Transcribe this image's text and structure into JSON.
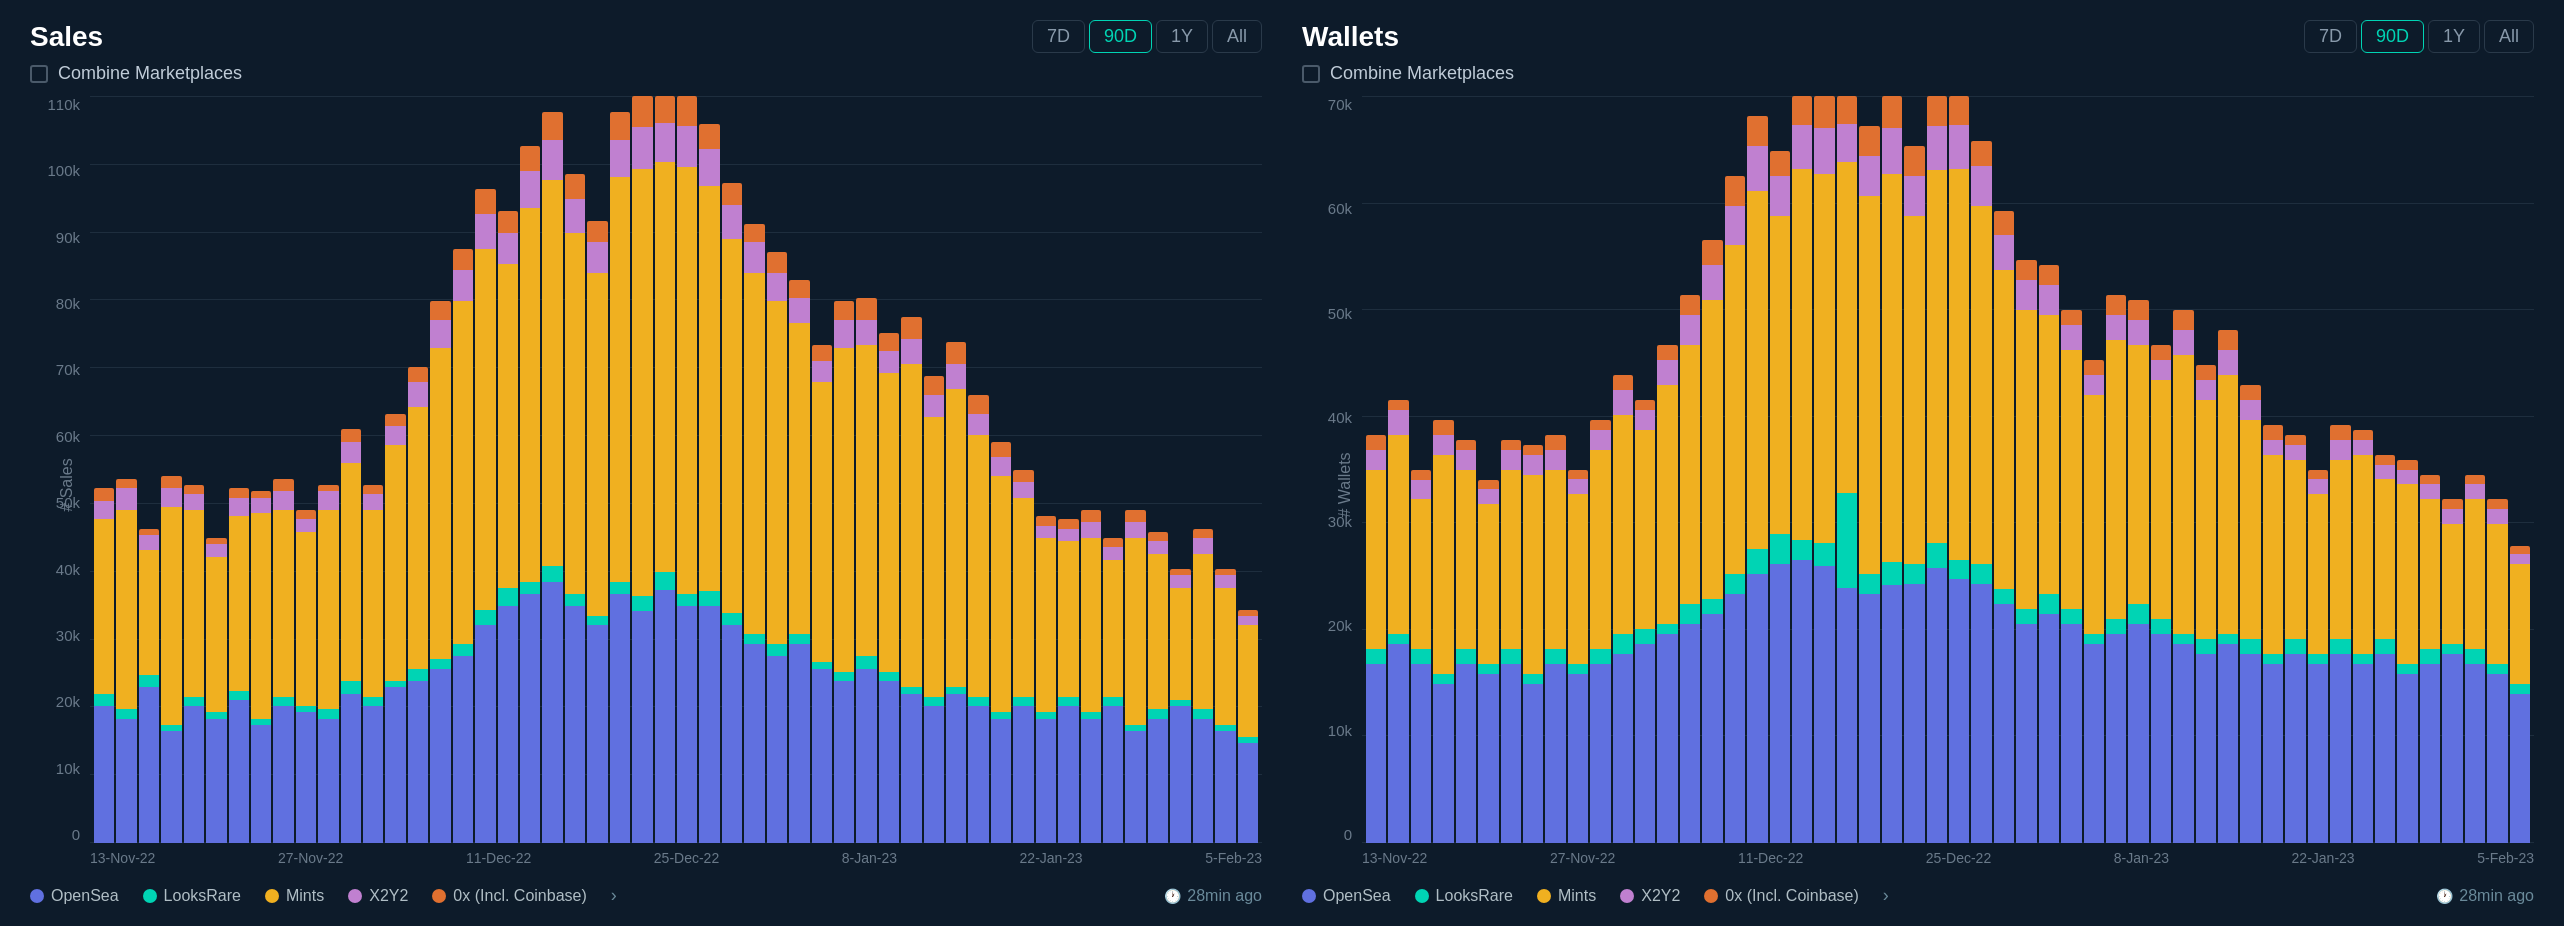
{
  "charts": [
    {
      "id": "sales",
      "title": "Sales",
      "yLabel": "# Sales",
      "yTicks": [
        "110k",
        "100k",
        "90k",
        "80k",
        "70k",
        "60k",
        "50k",
        "40k",
        "30k",
        "20k",
        "10k",
        "0"
      ],
      "maxVal": 120000,
      "xLabels": [
        "13-Nov-22",
        "27-Nov-22",
        "11-Dec-22",
        "25-Dec-22",
        "8-Jan-23",
        "22-Jan-23",
        "5-Feb-23"
      ],
      "activeFilter": "90D",
      "filters": [
        "7D",
        "90D",
        "1Y",
        "All"
      ],
      "combineLabel": "Combine Marketplaces"
    },
    {
      "id": "wallets",
      "title": "Wallets",
      "yLabel": "# Wallets",
      "yTicks": [
        "70k",
        "60k",
        "50k",
        "40k",
        "30k",
        "20k",
        "10k",
        "0"
      ],
      "maxVal": 75000,
      "xLabels": [
        "13-Nov-22",
        "27-Nov-22",
        "11-Dec-22",
        "25-Dec-22",
        "8-Jan-23",
        "22-Jan-23",
        "5-Feb-23"
      ],
      "activeFilter": "90D",
      "filters": [
        "7D",
        "90D",
        "1Y",
        "All"
      ],
      "combineLabel": "Combine Marketplaces"
    }
  ],
  "legend": {
    "items": [
      {
        "label": "OpenSea",
        "color": "#6070e0"
      },
      {
        "label": "LooksRare",
        "color": "#00d4b4"
      },
      {
        "label": "Mints",
        "color": "#f0b020"
      },
      {
        "label": "X2Y2",
        "color": "#c080d0"
      },
      {
        "label": "0x (Incl. Coinbase)",
        "color": "#e07030"
      }
    ],
    "moreLabel": ">",
    "timestamp": "28min ago"
  },
  "salesBars": [
    {
      "opensea": 22000,
      "looksrare": 2000,
      "mints": 28000,
      "x2y2": 3000,
      "ox": 2000
    },
    {
      "opensea": 20000,
      "looksrare": 1500,
      "mints": 32000,
      "x2y2": 3500,
      "ox": 1500
    },
    {
      "opensea": 25000,
      "looksrare": 2000,
      "mints": 20000,
      "x2y2": 2500,
      "ox": 1000
    },
    {
      "opensea": 18000,
      "looksrare": 1000,
      "mints": 35000,
      "x2y2": 3000,
      "ox": 2000
    },
    {
      "opensea": 22000,
      "looksrare": 1500,
      "mints": 30000,
      "x2y2": 2500,
      "ox": 1500
    },
    {
      "opensea": 20000,
      "looksrare": 1000,
      "mints": 25000,
      "x2y2": 2000,
      "ox": 1000
    },
    {
      "opensea": 23000,
      "looksrare": 1500,
      "mints": 28000,
      "x2y2": 3000,
      "ox": 1500
    },
    {
      "opensea": 19000,
      "looksrare": 1000,
      "mints": 33000,
      "x2y2": 2500,
      "ox": 1000
    },
    {
      "opensea": 22000,
      "looksrare": 1500,
      "mints": 30000,
      "x2y2": 3000,
      "ox": 2000
    },
    {
      "opensea": 21000,
      "looksrare": 1000,
      "mints": 28000,
      "x2y2": 2000,
      "ox": 1500
    },
    {
      "opensea": 20000,
      "looksrare": 1500,
      "mints": 32000,
      "x2y2": 3000,
      "ox": 1000
    },
    {
      "opensea": 24000,
      "looksrare": 2000,
      "mints": 35000,
      "x2y2": 3500,
      "ox": 2000
    },
    {
      "opensea": 22000,
      "looksrare": 1500,
      "mints": 30000,
      "x2y2": 2500,
      "ox": 1500
    },
    {
      "opensea": 25000,
      "looksrare": 1000,
      "mints": 38000,
      "x2y2": 3000,
      "ox": 2000
    },
    {
      "opensea": 26000,
      "looksrare": 2000,
      "mints": 42000,
      "x2y2": 4000,
      "ox": 2500
    },
    {
      "opensea": 28000,
      "looksrare": 1500,
      "mints": 50000,
      "x2y2": 4500,
      "ox": 3000
    },
    {
      "opensea": 30000,
      "looksrare": 2000,
      "mints": 55000,
      "x2y2": 5000,
      "ox": 3500
    },
    {
      "opensea": 35000,
      "looksrare": 2500,
      "mints": 58000,
      "x2y2": 5500,
      "ox": 4000
    },
    {
      "opensea": 38000,
      "looksrare": 3000,
      "mints": 52000,
      "x2y2": 5000,
      "ox": 3500
    },
    {
      "opensea": 40000,
      "looksrare": 2000,
      "mints": 60000,
      "x2y2": 6000,
      "ox": 4000
    },
    {
      "opensea": 42000,
      "looksrare": 2500,
      "mints": 62000,
      "x2y2": 6500,
      "ox": 4500
    },
    {
      "opensea": 38000,
      "looksrare": 2000,
      "mints": 58000,
      "x2y2": 5500,
      "ox": 4000
    },
    {
      "opensea": 35000,
      "looksrare": 1500,
      "mints": 55000,
      "x2y2": 5000,
      "ox": 3500
    },
    {
      "opensea": 40000,
      "looksrare": 2000,
      "mints": 65000,
      "x2y2": 6000,
      "ox": 4500
    },
    {
      "opensea": 38000,
      "looksrare": 2500,
      "mints": 70000,
      "x2y2": 7000,
      "ox": 5000
    },
    {
      "opensea": 42000,
      "looksrare": 3000,
      "mints": 68000,
      "x2y2": 6500,
      "ox": 4500
    },
    {
      "opensea": 40000,
      "looksrare": 2000,
      "mints": 72000,
      "x2y2": 7000,
      "ox": 5000
    },
    {
      "opensea": 38000,
      "looksrare": 2500,
      "mints": 65000,
      "x2y2": 6000,
      "ox": 4000
    },
    {
      "opensea": 35000,
      "looksrare": 2000,
      "mints": 60000,
      "x2y2": 5500,
      "ox": 3500
    },
    {
      "opensea": 32000,
      "looksrare": 1500,
      "mints": 58000,
      "x2y2": 5000,
      "ox": 3000
    },
    {
      "opensea": 30000,
      "looksrare": 2000,
      "mints": 55000,
      "x2y2": 4500,
      "ox": 3500
    },
    {
      "opensea": 32000,
      "looksrare": 1500,
      "mints": 50000,
      "x2y2": 4000,
      "ox": 3000
    },
    {
      "opensea": 28000,
      "looksrare": 1000,
      "mints": 45000,
      "x2y2": 3500,
      "ox": 2500
    },
    {
      "opensea": 26000,
      "looksrare": 1500,
      "mints": 52000,
      "x2y2": 4500,
      "ox": 3000
    },
    {
      "opensea": 28000,
      "looksrare": 2000,
      "mints": 50000,
      "x2y2": 4000,
      "ox": 3500
    },
    {
      "opensea": 26000,
      "looksrare": 1500,
      "mints": 48000,
      "x2y2": 3500,
      "ox": 3000
    },
    {
      "opensea": 24000,
      "looksrare": 1000,
      "mints": 52000,
      "x2y2": 4000,
      "ox": 3500
    },
    {
      "opensea": 22000,
      "looksrare": 1500,
      "mints": 45000,
      "x2y2": 3500,
      "ox": 3000
    },
    {
      "opensea": 24000,
      "looksrare": 1000,
      "mints": 48000,
      "x2y2": 4000,
      "ox": 3500
    },
    {
      "opensea": 22000,
      "looksrare": 1500,
      "mints": 42000,
      "x2y2": 3500,
      "ox": 3000
    },
    {
      "opensea": 20000,
      "looksrare": 1000,
      "mints": 38000,
      "x2y2": 3000,
      "ox": 2500
    },
    {
      "opensea": 22000,
      "looksrare": 1500,
      "mints": 32000,
      "x2y2": 2500,
      "ox": 2000
    },
    {
      "opensea": 20000,
      "looksrare": 1000,
      "mints": 28000,
      "x2y2": 2000,
      "ox": 1500
    },
    {
      "opensea": 22000,
      "looksrare": 1500,
      "mints": 25000,
      "x2y2": 2000,
      "ox": 1500
    },
    {
      "opensea": 20000,
      "looksrare": 1000,
      "mints": 28000,
      "x2y2": 2500,
      "ox": 2000
    },
    {
      "opensea": 22000,
      "looksrare": 1500,
      "mints": 22000,
      "x2y2": 2000,
      "ox": 1500
    },
    {
      "opensea": 18000,
      "looksrare": 1000,
      "mints": 30000,
      "x2y2": 2500,
      "ox": 2000
    },
    {
      "opensea": 20000,
      "looksrare": 1500,
      "mints": 25000,
      "x2y2": 2000,
      "ox": 1500
    },
    {
      "opensea": 22000,
      "looksrare": 1000,
      "mints": 18000,
      "x2y2": 2000,
      "ox": 1000
    },
    {
      "opensea": 20000,
      "looksrare": 1500,
      "mints": 25000,
      "x2y2": 2500,
      "ox": 1500
    },
    {
      "opensea": 18000,
      "looksrare": 1000,
      "mints": 22000,
      "x2y2": 2000,
      "ox": 1000
    },
    {
      "opensea": 16000,
      "looksrare": 1000,
      "mints": 18000,
      "x2y2": 1500,
      "ox": 1000
    }
  ],
  "walletsBars": [
    {
      "opensea": 18000,
      "looksrare": 1500,
      "mints": 18000,
      "x2y2": 2000,
      "ox": 1500
    },
    {
      "opensea": 20000,
      "looksrare": 1000,
      "mints": 20000,
      "x2y2": 2500,
      "ox": 1000
    },
    {
      "opensea": 18000,
      "looksrare": 1500,
      "mints": 15000,
      "x2y2": 2000,
      "ox": 1000
    },
    {
      "opensea": 16000,
      "looksrare": 1000,
      "mints": 22000,
      "x2y2": 2000,
      "ox": 1500
    },
    {
      "opensea": 18000,
      "looksrare": 1500,
      "mints": 18000,
      "x2y2": 2000,
      "ox": 1000
    },
    {
      "opensea": 17000,
      "looksrare": 1000,
      "mints": 16000,
      "x2y2": 1500,
      "ox": 1000
    },
    {
      "opensea": 18000,
      "looksrare": 1500,
      "mints": 18000,
      "x2y2": 2000,
      "ox": 1000
    },
    {
      "opensea": 16000,
      "looksrare": 1000,
      "mints": 20000,
      "x2y2": 2000,
      "ox": 1000
    },
    {
      "opensea": 18000,
      "looksrare": 1500,
      "mints": 18000,
      "x2y2": 2000,
      "ox": 1500
    },
    {
      "opensea": 17000,
      "looksrare": 1000,
      "mints": 17000,
      "x2y2": 1500,
      "ox": 1000
    },
    {
      "opensea": 18000,
      "looksrare": 1500,
      "mints": 20000,
      "x2y2": 2000,
      "ox": 1000
    },
    {
      "opensea": 19000,
      "looksrare": 2000,
      "mints": 22000,
      "x2y2": 2500,
      "ox": 1500
    },
    {
      "opensea": 20000,
      "looksrare": 1500,
      "mints": 20000,
      "x2y2": 2000,
      "ox": 1000
    },
    {
      "opensea": 21000,
      "looksrare": 1000,
      "mints": 24000,
      "x2y2": 2500,
      "ox": 1500
    },
    {
      "opensea": 22000,
      "looksrare": 2000,
      "mints": 26000,
      "x2y2": 3000,
      "ox": 2000
    },
    {
      "opensea": 23000,
      "looksrare": 1500,
      "mints": 30000,
      "x2y2": 3500,
      "ox": 2500
    },
    {
      "opensea": 25000,
      "looksrare": 2000,
      "mints": 33000,
      "x2y2": 4000,
      "ox": 3000
    },
    {
      "opensea": 27000,
      "looksrare": 2500,
      "mints": 36000,
      "x2y2": 4500,
      "ox": 3000
    },
    {
      "opensea": 28000,
      "looksrare": 3000,
      "mints": 32000,
      "x2y2": 4000,
      "ox": 2500
    },
    {
      "opensea": 29000,
      "looksrare": 2000,
      "mints": 38000,
      "x2y2": 4500,
      "ox": 3000
    },
    {
      "opensea": 30000,
      "looksrare": 2500,
      "mints": 40000,
      "x2y2": 5000,
      "ox": 3500
    },
    {
      "opensea": 27000,
      "looksrare": 10000,
      "mints": 35000,
      "x2y2": 4000,
      "ox": 3000
    },
    {
      "opensea": 25000,
      "looksrare": 2000,
      "mints": 38000,
      "x2y2": 4000,
      "ox": 3000
    },
    {
      "opensea": 28000,
      "looksrare": 2500,
      "mints": 42000,
      "x2y2": 5000,
      "ox": 3500
    },
    {
      "opensea": 26000,
      "looksrare": 2000,
      "mints": 35000,
      "x2y2": 4000,
      "ox": 3000
    },
    {
      "opensea": 28000,
      "looksrare": 2500,
      "mints": 38000,
      "x2y2": 4500,
      "ox": 3000
    },
    {
      "opensea": 27000,
      "looksrare": 2000,
      "mints": 40000,
      "x2y2": 4500,
      "ox": 3000
    },
    {
      "opensea": 26000,
      "looksrare": 2000,
      "mints": 36000,
      "x2y2": 4000,
      "ox": 2500
    },
    {
      "opensea": 24000,
      "looksrare": 1500,
      "mints": 32000,
      "x2y2": 3500,
      "ox": 2500
    },
    {
      "opensea": 22000,
      "looksrare": 1500,
      "mints": 30000,
      "x2y2": 3000,
      "ox": 2000
    },
    {
      "opensea": 23000,
      "looksrare": 2000,
      "mints": 28000,
      "x2y2": 3000,
      "ox": 2000
    },
    {
      "opensea": 22000,
      "looksrare": 1500,
      "mints": 26000,
      "x2y2": 2500,
      "ox": 1500
    },
    {
      "opensea": 20000,
      "looksrare": 1000,
      "mints": 24000,
      "x2y2": 2000,
      "ox": 1500
    },
    {
      "opensea": 21000,
      "looksrare": 1500,
      "mints": 28000,
      "x2y2": 2500,
      "ox": 2000
    },
    {
      "opensea": 22000,
      "looksrare": 2000,
      "mints": 26000,
      "x2y2": 2500,
      "ox": 2000
    },
    {
      "opensea": 21000,
      "looksrare": 1500,
      "mints": 24000,
      "x2y2": 2000,
      "ox": 1500
    },
    {
      "opensea": 20000,
      "looksrare": 1000,
      "mints": 28000,
      "x2y2": 2500,
      "ox": 2000
    },
    {
      "opensea": 19000,
      "looksrare": 1500,
      "mints": 24000,
      "x2y2": 2000,
      "ox": 1500
    },
    {
      "opensea": 20000,
      "looksrare": 1000,
      "mints": 26000,
      "x2y2": 2500,
      "ox": 2000
    },
    {
      "opensea": 19000,
      "looksrare": 1500,
      "mints": 22000,
      "x2y2": 2000,
      "ox": 1500
    },
    {
      "opensea": 18000,
      "looksrare": 1000,
      "mints": 20000,
      "x2y2": 1500,
      "ox": 1500
    },
    {
      "opensea": 19000,
      "looksrare": 1500,
      "mints": 18000,
      "x2y2": 1500,
      "ox": 1000
    },
    {
      "opensea": 18000,
      "looksrare": 1000,
      "mints": 16000,
      "x2y2": 1500,
      "ox": 1000
    },
    {
      "opensea": 19000,
      "looksrare": 1500,
      "mints": 18000,
      "x2y2": 2000,
      "ox": 1500
    },
    {
      "opensea": 18000,
      "looksrare": 1000,
      "mints": 20000,
      "x2y2": 1500,
      "ox": 1000
    },
    {
      "opensea": 19000,
      "looksrare": 1500,
      "mints": 16000,
      "x2y2": 1500,
      "ox": 1000
    },
    {
      "opensea": 17000,
      "looksrare": 1000,
      "mints": 18000,
      "x2y2": 1500,
      "ox": 1000
    },
    {
      "opensea": 18000,
      "looksrare": 1500,
      "mints": 15000,
      "x2y2": 1500,
      "ox": 1000
    },
    {
      "opensea": 19000,
      "looksrare": 1000,
      "mints": 12000,
      "x2y2": 1500,
      "ox": 1000
    },
    {
      "opensea": 18000,
      "looksrare": 1500,
      "mints": 15000,
      "x2y2": 1500,
      "ox": 1000
    },
    {
      "opensea": 17000,
      "looksrare": 1000,
      "mints": 14000,
      "x2y2": 1500,
      "ox": 1000
    },
    {
      "opensea": 15000,
      "looksrare": 1000,
      "mints": 12000,
      "x2y2": 1000,
      "ox": 800
    }
  ]
}
